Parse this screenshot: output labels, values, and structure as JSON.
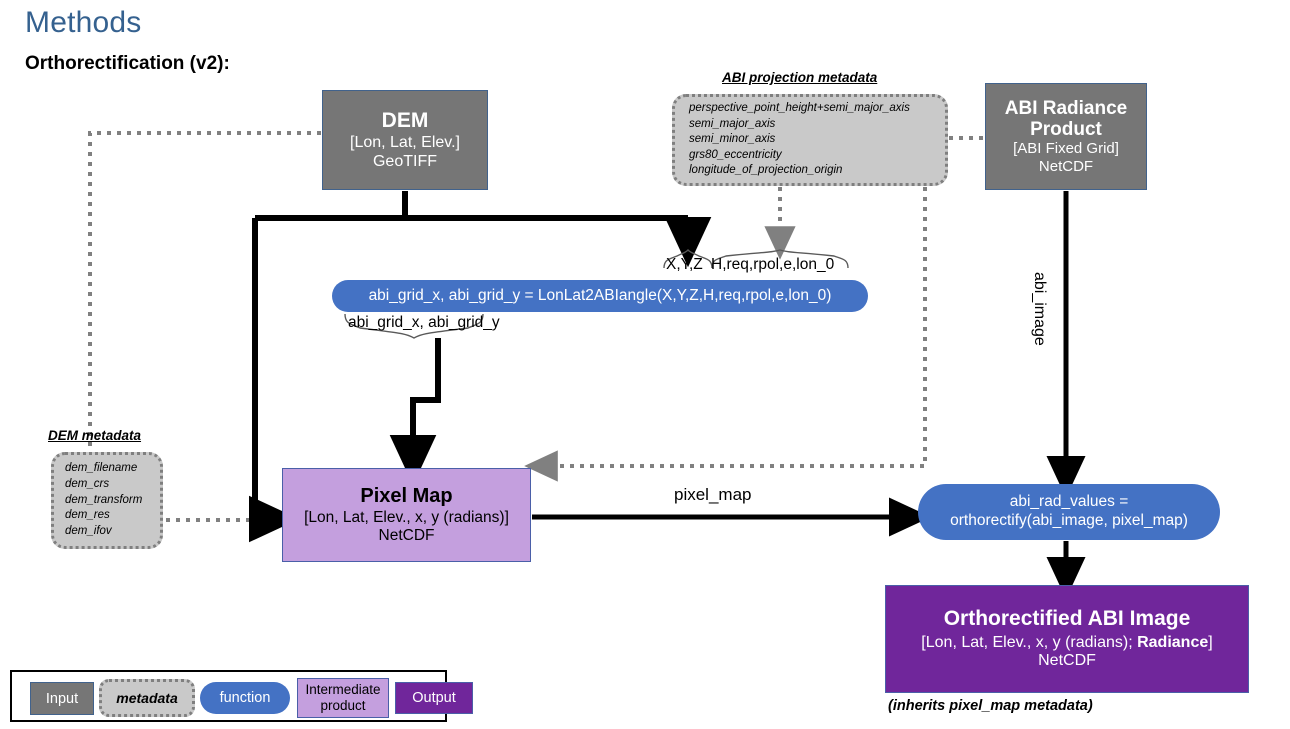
{
  "page": {
    "title": "Methods",
    "subtitle": "Orthorectification (v2):"
  },
  "nodes": {
    "dem": {
      "name": "DEM",
      "fields": "[Lon, Lat, Elev.]",
      "format": "GeoTIFF"
    },
    "abi_radiance": {
      "name": "ABI Radiance Product",
      "fields": "[ABI Fixed Grid]",
      "format": "NetCDF"
    },
    "pixel_map": {
      "name": "Pixel Map",
      "fields": "[Lon, Lat, Elev., x, y (radians)]",
      "format": "NetCDF"
    },
    "orthorectified": {
      "name": "Orthorectified ABI Image",
      "fields_pre": "[Lon, Lat, Elev., x, y (radians); ",
      "fields_bold": "Radiance",
      "fields_post": "]",
      "format": "NetCDF",
      "note": "(inherits pixel_map metadata)"
    }
  },
  "metadata": {
    "abi_projection": {
      "title": "ABI projection metadata",
      "items": [
        "perspective_point_height+semi_major_axis",
        "semi_major_axis",
        "semi_minor_axis",
        "grs80_eccentricity",
        "longitude_of_projection_origin"
      ]
    },
    "dem": {
      "title": "DEM metadata",
      "items": [
        "dem_filename",
        "dem_crs",
        "dem_transform",
        "dem_res",
        "dem_ifov"
      ]
    }
  },
  "functions": {
    "lonlat2abiangle": "abi_grid_x, abi_grid_y = LonLat2ABIangle(X,Y,Z,H,req,rpol,e,lon_0)",
    "orthorectify_l1": "abi_rad_values =",
    "orthorectify_l2": "orthorectify(abi_image, pixel_map)"
  },
  "labels": {
    "xyz": "X,Y,Z",
    "hreq": "H,req,rpol,e,lon_0",
    "abi_grid": "abi_grid_x, abi_grid_y",
    "pixel_map_edge": "pixel_map",
    "abi_image_edge": "abi_image"
  },
  "legend": {
    "input": "Input",
    "metadata": "metadata",
    "function": "function",
    "intermediate_l1": "Intermediate",
    "intermediate_l2": "product",
    "output": "Output"
  },
  "colors": {
    "title_blue": "#35618F",
    "input_gray": "#767676",
    "metadata_gray": "#C9C9C9",
    "function_blue": "#4472C4",
    "intermediate_purple": "#C49FDE",
    "output_purple": "#70269B",
    "solid_arrow": "#000000",
    "dashed_arrow": "#808080"
  }
}
